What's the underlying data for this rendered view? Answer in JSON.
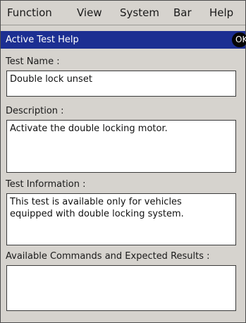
{
  "menubar": {
    "items": [
      {
        "label": "Function"
      },
      {
        "label": "View"
      },
      {
        "label": "System"
      },
      {
        "label": "Bar"
      },
      {
        "label": "Help"
      }
    ]
  },
  "dialog": {
    "title": "Active Test Help",
    "ok_label": "OK"
  },
  "fields": {
    "test_name": {
      "label": "Test Name :",
      "value": "Double lock unset"
    },
    "description": {
      "label": "Description :",
      "value": "Activate the double locking motor."
    },
    "test_information": {
      "label": "Test Information :",
      "value": "This test is available only for vehicles\nequipped with double locking system."
    },
    "commands": {
      "label": "Available Commands and Expected Results :",
      "value": ""
    }
  },
  "colors": {
    "titlebar": "#1c2f92",
    "background": "#d6d3ce",
    "field": "#ffffff"
  }
}
